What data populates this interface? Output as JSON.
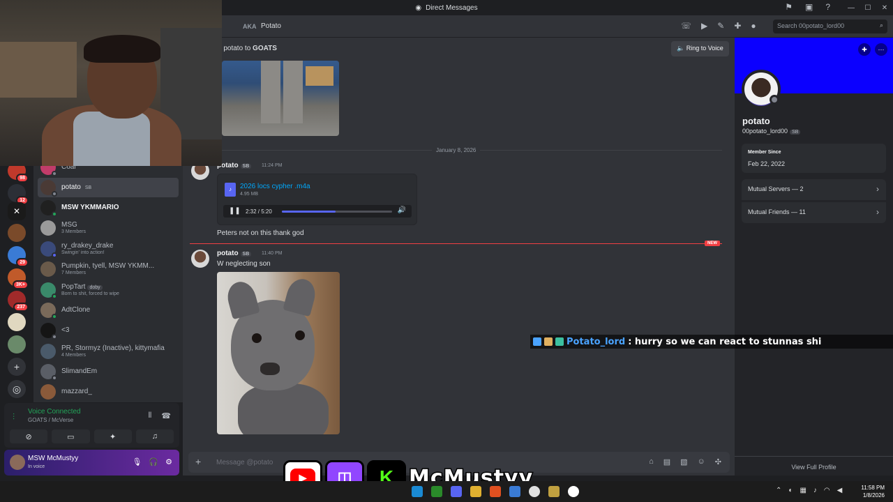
{
  "titlebar": {
    "title": "Direct Messages"
  },
  "rail": {
    "servers": [
      {
        "badge": "98",
        "color": "#c0392b"
      },
      {
        "badge": "12",
        "color": "#2c2f36"
      },
      {
        "badge": "",
        "color": "#1a1a1a"
      },
      {
        "badge": "",
        "color": "#7a4a2a"
      },
      {
        "badge": "29",
        "color": "#3a7bd5"
      },
      {
        "badge": "3K+",
        "color": "#c05a2a"
      },
      {
        "badge": "237",
        "color": "#a02a2a"
      },
      {
        "badge": "",
        "color": "#e0d8c0"
      },
      {
        "badge": "",
        "color": "#6a8a6a"
      }
    ]
  },
  "dms": [
    {
      "name": "Coal",
      "sub": ""
    },
    {
      "name": "potato",
      "tag": "SB",
      "sub": ""
    },
    {
      "name": "MSW YKMMARIO",
      "sub": ""
    },
    {
      "name": "MSG",
      "sub": "3 Members"
    },
    {
      "name": "ry_drakey_drake",
      "sub": "Swingin' into action!"
    },
    {
      "name": "Pumpkin, tyell, MSW YKMM...",
      "sub": "7 Members"
    },
    {
      "name": "PopTart",
      "tag": "doby",
      "sub": "Born to shit, forced to wipe"
    },
    {
      "name": "AdtClone",
      "sub": ""
    },
    {
      "name": "<3",
      "sub": ""
    },
    {
      "name": "PR, Stormyz (Inactive), kittymafia",
      "sub": "4 Members"
    },
    {
      "name": "SlimandEm",
      "sub": ""
    },
    {
      "name": "mazzard_",
      "sub": ""
    }
  ],
  "voice": {
    "status": "Voice Connected",
    "channel": "GOATS / McVerse"
  },
  "user": {
    "name": "MSW McMustyy",
    "status": "In voice"
  },
  "header": {
    "aka_label": "AKA",
    "aka_value": "Potato",
    "search_placeholder": "Search 00potato_lord00"
  },
  "call": {
    "description_prefix": "g potato to ",
    "description_target": "GOATS",
    "ring_label": "Ring to Voice"
  },
  "chat": {
    "date_divider": "January 8, 2026",
    "new_label": "NEW",
    "msg1": {
      "author": "potato",
      "tag": "SB",
      "time": "11:24 PM",
      "file_name": "2026 locs cypher .m4a",
      "file_size": "4.95 MB",
      "player_time": "2:32 / 5:20",
      "progress": 0.49,
      "followup": "Peters not on this thank god"
    },
    "msg2": {
      "author": "potato",
      "tag": "SB",
      "time": "11:40 PM",
      "text": "W neglecting son"
    },
    "composer_placeholder": "Message @potato"
  },
  "profile": {
    "display_name": "potato",
    "username": "00potato_lord00",
    "tag": "SB",
    "member_since_label": "Member Since",
    "member_since": "Feb 22, 2022",
    "mutual_servers": "Mutual Servers — 2",
    "mutual_friends": "Mutual Friends — 11",
    "view_full": "View Full Profile"
  },
  "overlay": {
    "chat_user": "Potato_lord",
    "chat_msg": ": hurry so we can react to stunnas shi",
    "handle": "McMustyy"
  },
  "taskbar": {
    "time": "11:58 PM",
    "date": "1/8/2026"
  },
  "colors": {
    "accent": "#5865f2",
    "banner": "#0b00ff",
    "danger": "#f23f43",
    "online": "#23a559"
  }
}
